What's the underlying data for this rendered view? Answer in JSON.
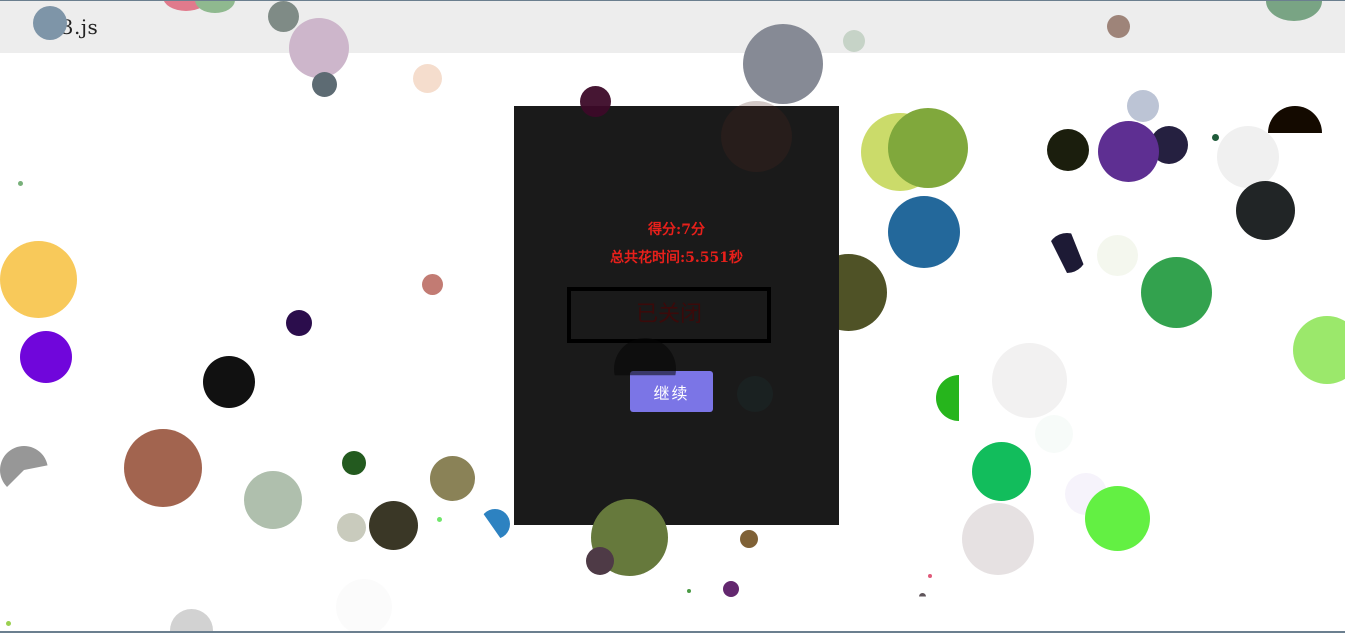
{
  "header": {
    "title": "s3.js"
  },
  "dialog": {
    "score_text": "得分:7分",
    "time_text": "总共花时间:5.551秒",
    "status_text": "已关闭",
    "continue_label": "继续"
  },
  "colors": {
    "dialog_background": "#1a1a1a",
    "score_text": "#e8201b",
    "continue_button": "#7b75e6",
    "title_bar": "#ededed"
  }
}
